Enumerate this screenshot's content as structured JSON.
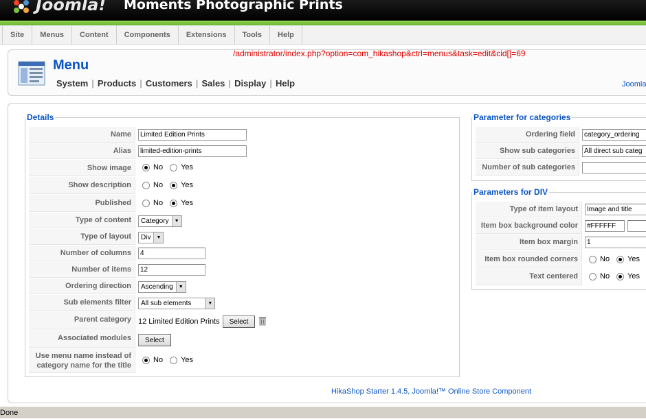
{
  "header": {
    "logo_text": "Joomla!",
    "site_title": "Moments Photographic Prints"
  },
  "menubar": [
    "Site",
    "Menus",
    "Content",
    "Components",
    "Extensions",
    "Tools",
    "Help"
  ],
  "toolbar": {
    "url": "/administrator/index.php?option=com_hikashop&ctrl=menus&task=edit&cid[]=69",
    "page_title": "Menu",
    "submenu": [
      "System",
      "Products",
      "Customers",
      "Sales",
      "Display",
      "Help"
    ],
    "right_link": "Joomla"
  },
  "details": {
    "legend": "Details",
    "name_label": "Name",
    "name_value": "Limited Edition Prints",
    "alias_label": "Alias",
    "alias_value": "limited-edition-prints",
    "show_image_label": "Show image",
    "show_description_label": "Show description",
    "published_label": "Published",
    "no": "No",
    "yes": "Yes",
    "type_content_label": "Type of content",
    "type_content_value": "Category",
    "type_layout_label": "Type of layout",
    "type_layout_value": "Div",
    "num_columns_label": "Number of columns",
    "num_columns_value": "4",
    "num_items_label": "Number of items",
    "num_items_value": "12",
    "ordering_dir_label": "Ordering direction",
    "ordering_dir_value": "Ascending",
    "sub_filter_label": "Sub elements filter",
    "sub_filter_value": "All sub elements",
    "parent_cat_label": "Parent category",
    "parent_cat_value": "12 Limited Edition Prints",
    "select_label": "Select",
    "assoc_modules_label": "Associated modules",
    "use_menu_name_label_1": "Use menu name instead of",
    "use_menu_name_label_2": "category name for the title"
  },
  "params_categories": {
    "legend": "Parameter for categories",
    "ordering_field_label": "Ordering field",
    "ordering_field_value": "category_ordering",
    "show_sub_label": "Show sub categories",
    "show_sub_value": "All direct sub categ",
    "num_sub_label": "Number of sub categories",
    "num_sub_value": ""
  },
  "params_div": {
    "legend": "Parameters for DIV",
    "type_item_layout_label": "Type of item layout",
    "type_item_layout_value": "Image and title",
    "bg_color_label": "Item box background color",
    "bg_color_value": "#FFFFFF",
    "margin_label": "Item box margin",
    "margin_value": "1",
    "rounded_label": "Item box rounded corners",
    "text_centered_label": "Text centered"
  },
  "footer": "HikaShop Starter 1.4.5, Joomla!™ Online Store Component",
  "status": "Done"
}
